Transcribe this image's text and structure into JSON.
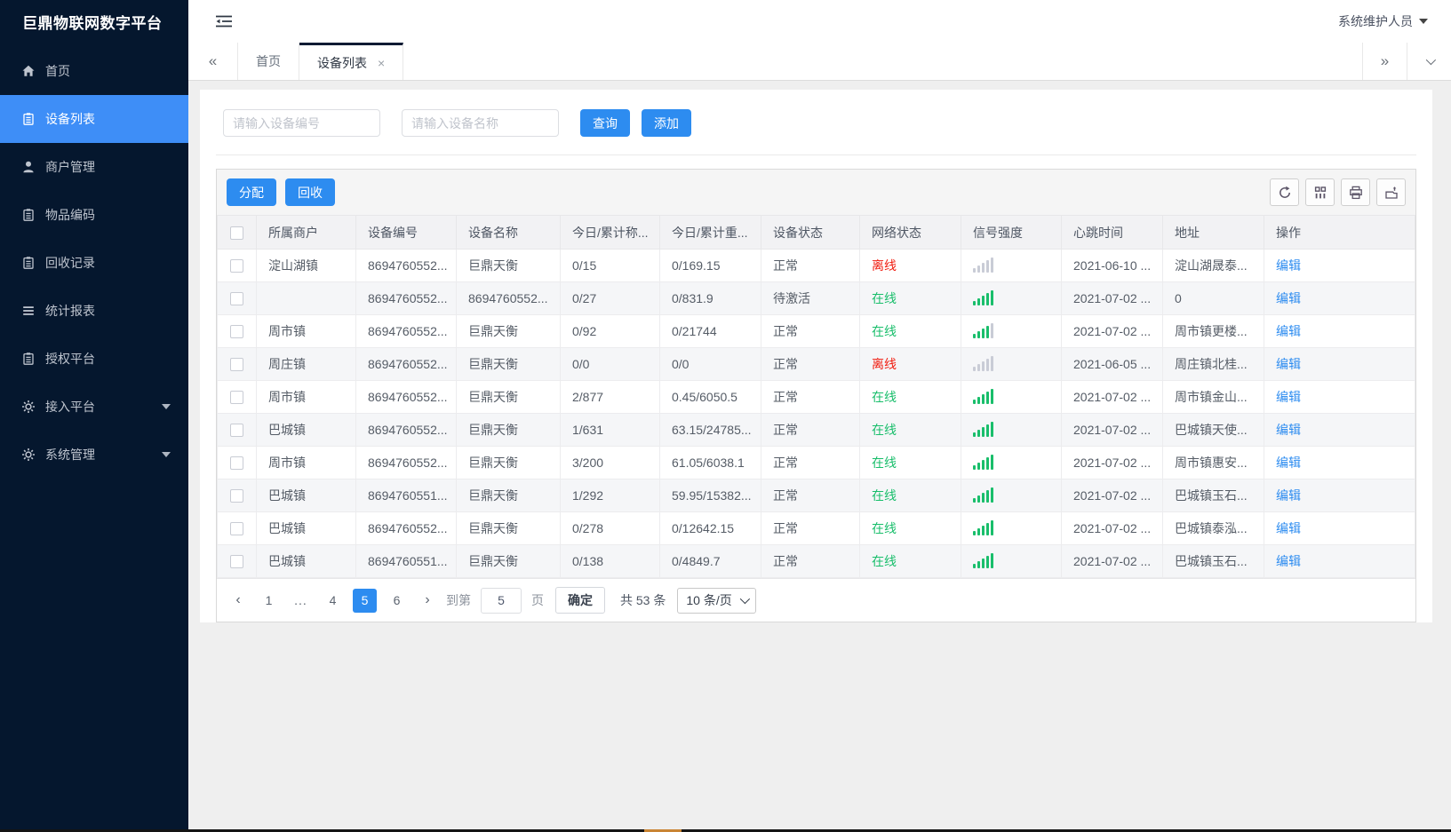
{
  "colors": {
    "primary": "#2d8cf0",
    "sidebar_bg": "#05172e",
    "active_item": "#3e8ef7",
    "tab_accent": "#0c1b33",
    "online": "#19be6b",
    "offline": "#f01d10"
  },
  "app": {
    "logo_text": "巨鼎物联网数字平台",
    "user_name": "系统维护人员"
  },
  "sidebar": {
    "items": [
      {
        "label": "首页",
        "icon": "home-icon",
        "active": false,
        "caret": false
      },
      {
        "label": "设备列表",
        "icon": "device-list-icon",
        "active": true,
        "caret": false
      },
      {
        "label": "商户管理",
        "icon": "merchant-icon",
        "active": false,
        "caret": false
      },
      {
        "label": "物品编码",
        "icon": "item-code-icon",
        "active": false,
        "caret": false
      },
      {
        "label": "回收记录",
        "icon": "recycle-record-icon",
        "active": false,
        "caret": false
      },
      {
        "label": "统计报表",
        "icon": "report-icon",
        "active": false,
        "caret": false
      },
      {
        "label": "授权平台",
        "icon": "authorize-icon",
        "active": false,
        "caret": false
      },
      {
        "label": "接入平台",
        "icon": "access-platform-icon",
        "active": false,
        "caret": true
      },
      {
        "label": "系统管理",
        "icon": "system-manage-icon",
        "active": false,
        "caret": true
      }
    ]
  },
  "tabs": {
    "back_icon": "«",
    "forward_icon": "»",
    "close_icon": "×",
    "items": [
      {
        "label": "首页",
        "active": false,
        "closable": false
      },
      {
        "label": "设备列表",
        "active": true,
        "closable": true
      }
    ]
  },
  "search": {
    "device_no_placeholder": "请输入设备编号",
    "device_name_placeholder": "请输入设备名称",
    "query_label": "查询",
    "add_label": "添加"
  },
  "toolbar": {
    "assign_label": "分配",
    "recycle_label": "回收",
    "icons": [
      "refresh-icon",
      "column-settings-icon",
      "print-icon",
      "export-icon"
    ]
  },
  "table": {
    "headers": [
      "所属商户",
      "设备编号",
      "设备名称",
      "今日/累计称...",
      "今日/累计重...",
      "设备状态",
      "网络状态",
      "信号强度",
      "心跳时间",
      "地址",
      "操作"
    ],
    "rows": [
      {
        "merchant": "淀山湖镇",
        "device_no": "8694760552...",
        "device_name": "巨鼎天衡",
        "count": "0/15",
        "weight": "0/169.15",
        "status": "正常",
        "network": "离线",
        "online": false,
        "signal_level": 0,
        "heartbeat": "2021-06-10 ...",
        "address": "淀山湖晟泰...",
        "action": "编辑"
      },
      {
        "merchant": "",
        "device_no": "8694760552...",
        "device_name": "8694760552...",
        "count": "0/27",
        "weight": "0/831.9",
        "status": "待激活",
        "network": "在线",
        "online": true,
        "signal_level": 5,
        "heartbeat": "2021-07-02 ...",
        "address": "0",
        "action": "编辑"
      },
      {
        "merchant": "周市镇",
        "device_no": "8694760552...",
        "device_name": "巨鼎天衡",
        "count": "0/92",
        "weight": "0/21744",
        "status": "正常",
        "network": "在线",
        "online": true,
        "signal_level": 4,
        "heartbeat": "2021-07-02 ...",
        "address": "周市镇更楼...",
        "action": "编辑"
      },
      {
        "merchant": "周庄镇",
        "device_no": "8694760552...",
        "device_name": "巨鼎天衡",
        "count": "0/0",
        "weight": "0/0",
        "status": "正常",
        "network": "离线",
        "online": false,
        "signal_level": 0,
        "heartbeat": "2021-06-05 ...",
        "address": "周庄镇北桂...",
        "action": "编辑"
      },
      {
        "merchant": "周市镇",
        "device_no": "8694760552...",
        "device_name": "巨鼎天衡",
        "count": "2/877",
        "weight": "0.45/6050.5",
        "status": "正常",
        "network": "在线",
        "online": true,
        "signal_level": 5,
        "heartbeat": "2021-07-02 ...",
        "address": "周市镇金山...",
        "action": "编辑"
      },
      {
        "merchant": "巴城镇",
        "device_no": "8694760552...",
        "device_name": "巨鼎天衡",
        "count": "1/631",
        "weight": "63.15/24785...",
        "status": "正常",
        "network": "在线",
        "online": true,
        "signal_level": 5,
        "heartbeat": "2021-07-02 ...",
        "address": "巴城镇天使...",
        "action": "编辑"
      },
      {
        "merchant": "周市镇",
        "device_no": "8694760552...",
        "device_name": "巨鼎天衡",
        "count": "3/200",
        "weight": "61.05/6038.1",
        "status": "正常",
        "network": "在线",
        "online": true,
        "signal_level": 5,
        "heartbeat": "2021-07-02 ...",
        "address": "周市镇惠安...",
        "action": "编辑"
      },
      {
        "merchant": "巴城镇",
        "device_no": "8694760551...",
        "device_name": "巨鼎天衡",
        "count": "1/292",
        "weight": "59.95/15382...",
        "status": "正常",
        "network": "在线",
        "online": true,
        "signal_level": 5,
        "heartbeat": "2021-07-02 ...",
        "address": "巴城镇玉石...",
        "action": "编辑"
      },
      {
        "merchant": "巴城镇",
        "device_no": "8694760552...",
        "device_name": "巨鼎天衡",
        "count": "0/278",
        "weight": "0/12642.15",
        "status": "正常",
        "network": "在线",
        "online": true,
        "signal_level": 5,
        "heartbeat": "2021-07-02 ...",
        "address": "巴城镇泰泓...",
        "action": "编辑"
      },
      {
        "merchant": "巴城镇",
        "device_no": "8694760551...",
        "device_name": "巨鼎天衡",
        "count": "0/138",
        "weight": "0/4849.7",
        "status": "正常",
        "network": "在线",
        "online": true,
        "signal_level": 5,
        "heartbeat": "2021-07-02 ...",
        "address": "巴城镇玉石...",
        "action": "编辑"
      }
    ]
  },
  "pagination": {
    "prev_icon": "‹",
    "next_icon": "›",
    "pages": [
      "1",
      "...",
      "4",
      "5",
      "6"
    ],
    "active_page": "5",
    "goto_label": "到第",
    "goto_value": "5",
    "page_label": "页",
    "confirm_label": "确定",
    "total_label": "共 53 条",
    "page_size_label": "10 条/页"
  }
}
